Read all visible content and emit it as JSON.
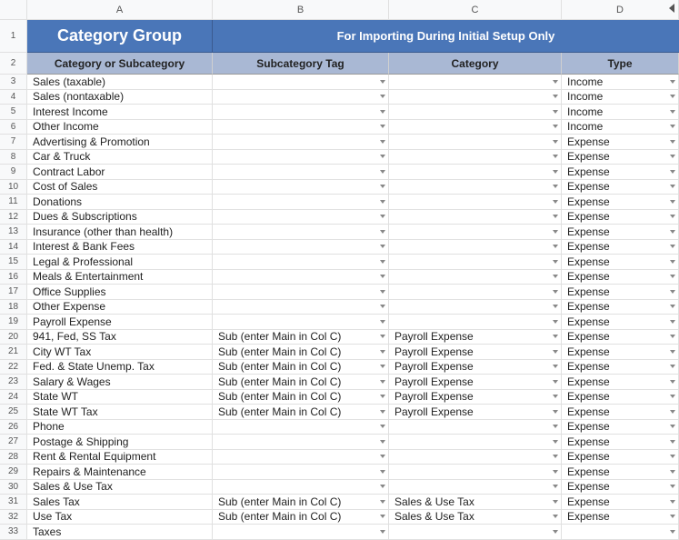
{
  "columns": [
    "A",
    "B",
    "C",
    "D"
  ],
  "banner": {
    "colA": "Category Group",
    "rest": "For Importing During Initial Setup Only"
  },
  "headers": {
    "a": "Category or Subcategory",
    "b": "Subcategory Tag",
    "c": "Category",
    "d": "Type"
  },
  "rows": [
    {
      "n": 3,
      "a": "Sales (taxable)",
      "b": "",
      "c": "",
      "d": "Income"
    },
    {
      "n": 4,
      "a": "Sales (nontaxable)",
      "b": "",
      "c": "",
      "d": "Income"
    },
    {
      "n": 5,
      "a": "Interest Income",
      "b": "",
      "c": "",
      "d": "Income"
    },
    {
      "n": 6,
      "a": "Other Income",
      "b": "",
      "c": "",
      "d": "Income"
    },
    {
      "n": 7,
      "a": "Advertising & Promotion",
      "b": "",
      "c": "",
      "d": "Expense"
    },
    {
      "n": 8,
      "a": "Car & Truck",
      "b": "",
      "c": "",
      "d": "Expense"
    },
    {
      "n": 9,
      "a": "Contract Labor",
      "b": "",
      "c": "",
      "d": "Expense"
    },
    {
      "n": 10,
      "a": "Cost of Sales",
      "b": "",
      "c": "",
      "d": "Expense"
    },
    {
      "n": 11,
      "a": "Donations",
      "b": "",
      "c": "",
      "d": "Expense"
    },
    {
      "n": 12,
      "a": "Dues & Subscriptions",
      "b": "",
      "c": "",
      "d": "Expense"
    },
    {
      "n": 13,
      "a": "Insurance (other than health)",
      "b": "",
      "c": "",
      "d": "Expense"
    },
    {
      "n": 14,
      "a": "Interest & Bank Fees",
      "b": "",
      "c": "",
      "d": "Expense"
    },
    {
      "n": 15,
      "a": "Legal & Professional",
      "b": "",
      "c": "",
      "d": "Expense"
    },
    {
      "n": 16,
      "a": "Meals & Entertainment",
      "b": "",
      "c": "",
      "d": "Expense"
    },
    {
      "n": 17,
      "a": "Office Supplies",
      "b": "",
      "c": "",
      "d": "Expense"
    },
    {
      "n": 18,
      "a": "Other Expense",
      "b": "",
      "c": "",
      "d": "Expense"
    },
    {
      "n": 19,
      "a": "Payroll Expense",
      "b": "",
      "c": "",
      "d": "Expense"
    },
    {
      "n": 20,
      "a": "941, Fed, SS Tax",
      "b": "Sub (enter Main in Col C)",
      "c": "Payroll Expense",
      "d": "Expense"
    },
    {
      "n": 21,
      "a": "City WT Tax",
      "b": "Sub (enter Main in Col C)",
      "c": "Payroll Expense",
      "d": "Expense"
    },
    {
      "n": 22,
      "a": "Fed. & State Unemp. Tax",
      "b": "Sub (enter Main in Col C)",
      "c": "Payroll Expense",
      "d": "Expense"
    },
    {
      "n": 23,
      "a": "Salary & Wages",
      "b": "Sub (enter Main in Col C)",
      "c": "Payroll Expense",
      "d": "Expense"
    },
    {
      "n": 24,
      "a": "State WT",
      "b": "Sub (enter Main in Col C)",
      "c": "Payroll Expense",
      "d": "Expense"
    },
    {
      "n": 25,
      "a": "State WT Tax",
      "b": "Sub (enter Main in Col C)",
      "c": "Payroll Expense",
      "d": "Expense"
    },
    {
      "n": 26,
      "a": "Phone",
      "b": "",
      "c": "",
      "d": "Expense"
    },
    {
      "n": 27,
      "a": "Postage & Shipping",
      "b": "",
      "c": "",
      "d": "Expense"
    },
    {
      "n": 28,
      "a": "Rent & Rental Equipment",
      "b": "",
      "c": "",
      "d": "Expense"
    },
    {
      "n": 29,
      "a": "Repairs & Maintenance",
      "b": "",
      "c": "",
      "d": "Expense"
    },
    {
      "n": 30,
      "a": "Sales & Use Tax",
      "b": "",
      "c": "",
      "d": "Expense"
    },
    {
      "n": 31,
      "a": "Sales Tax",
      "b": "Sub (enter Main in Col C)",
      "c": "Sales & Use Tax",
      "d": "Expense"
    },
    {
      "n": 32,
      "a": "Use Tax",
      "b": "Sub (enter Main in Col C)",
      "c": "Sales & Use Tax",
      "d": "Expense"
    },
    {
      "n": 33,
      "a": "Taxes",
      "b": "",
      "c": "",
      "d": ""
    }
  ]
}
